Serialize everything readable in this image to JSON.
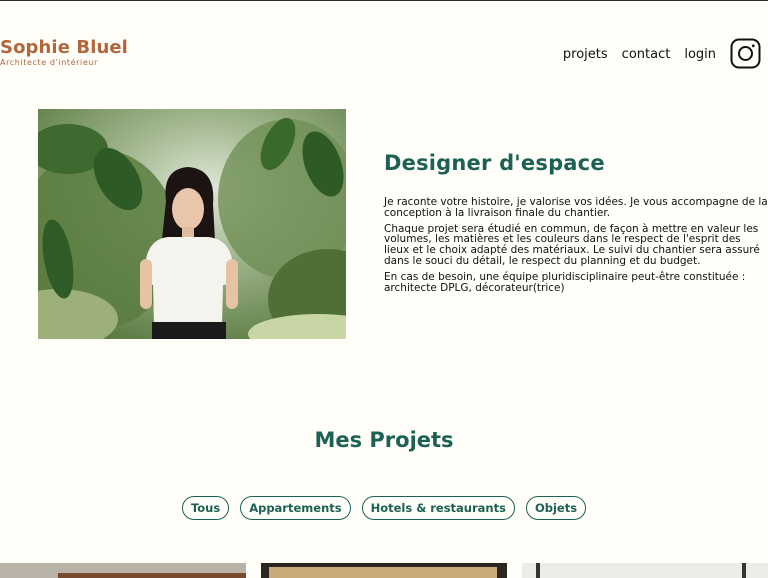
{
  "header": {
    "logo_title": "Sophie Bluel",
    "logo_subtitle": "Architecte d'intérieur",
    "nav": [
      "projets",
      "contact",
      "login"
    ],
    "social_icon": "instagram-icon"
  },
  "intro": {
    "title": "Designer d'espace",
    "paragraphs": [
      "Je raconte votre histoire, je valorise vos idées. Je vous accompagne de la conception à la livraison finale du chantier.",
      "Chaque projet sera étudié en commun, de façon à mettre en valeur les volumes, les matières et les couleurs dans le respect de l'esprit des lieux et le choix adapté des matériaux. Le suivi du chantier sera assuré dans le souci du détail, le respect du planning et du budget.",
      "En cas de besoin, une équipe pluridisciplinaire peut-être constituée : architecte DPLG, décorateur(trice)"
    ]
  },
  "projects": {
    "title": "Mes Projets",
    "filters": [
      "Tous",
      "Appartements",
      "Hotels & restaurants",
      "Objets"
    ]
  },
  "colors": {
    "background": "#FFFEF8",
    "brand": "#B1663C",
    "accent": "#1D6154"
  }
}
